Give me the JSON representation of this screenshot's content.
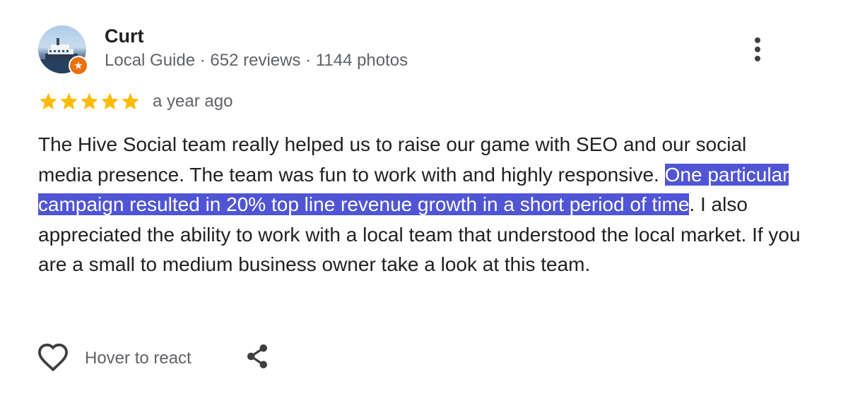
{
  "reviewer": {
    "name": "Curt",
    "meta": "Local Guide · 652 reviews · 1144 photos"
  },
  "review": {
    "rating": 5,
    "rating_max": 5,
    "date": "a year ago",
    "text_before_selection": "The Hive Social team really helped us to raise our game with SEO and our social media presence. The team was fun to work with and highly responsive. ",
    "text_selected": "One particular campaign resulted in 20% top line revenue growth in a short period of time",
    "text_after_selection": ". I also appreciated the ability to work with a local team that understood the local market. If you are a small to medium business owner take a look at this team."
  },
  "actions": {
    "react_label": "Hover to react",
    "react_icon": "heart-outline-icon",
    "share_icon": "share-icon",
    "more_icon": "more-vertical-icon"
  },
  "colors": {
    "star": "#fbbc04",
    "selection_highlight": "#5055d6",
    "guide_badge": "#e8710a",
    "secondary_text": "#5f6368"
  }
}
